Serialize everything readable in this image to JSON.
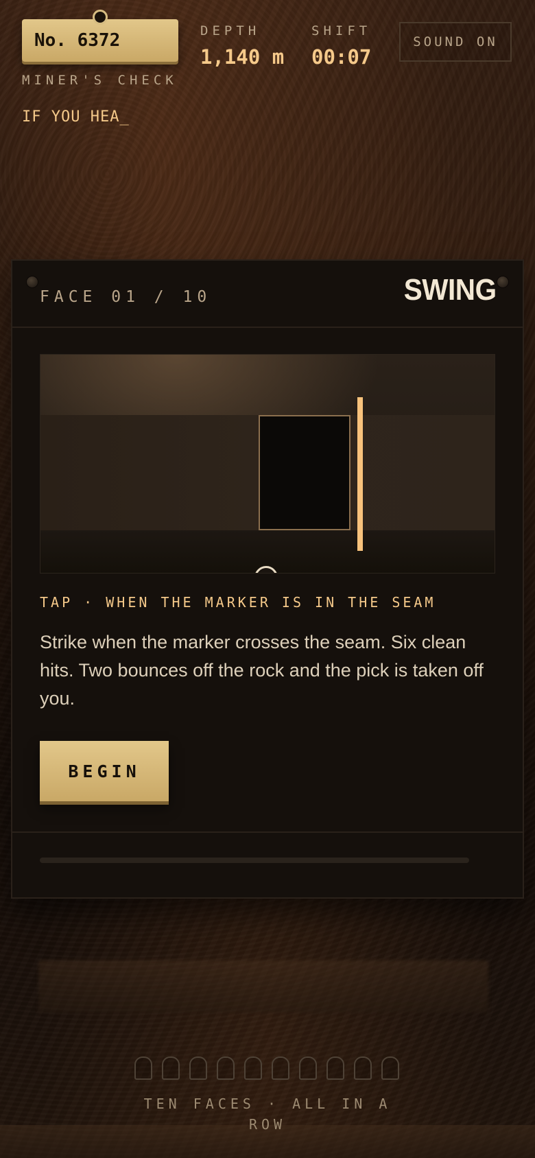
{
  "header": {
    "check_number": "No. 6372",
    "check_caption": "MINER'S CHECK",
    "depth": {
      "label": "DEPTH",
      "value": "1,140 m"
    },
    "shift": {
      "label": "SHIFT",
      "value": "00:07"
    },
    "sound_button": "SOUND ON",
    "ticker": "IF YOU HEA_"
  },
  "card": {
    "face_label": "FACE 01 / 10",
    "title": "SWING",
    "instruction_heading": "TAP · WHEN THE MARKER IS IN THE SEAM",
    "instruction_body": "Strike when the marker crosses the seam. Six clean hits. Two bounces off the rock and the pick is taken off you.",
    "begin_button": "BEGIN",
    "progress_fraction": 0
  },
  "footer": {
    "faces_total": 10,
    "faces_done": 0,
    "caption": "TEN FACES · ALL IN A ROW"
  },
  "colors": {
    "accent": "#f5c98a",
    "brass": "#c9a866",
    "marker": "#f8c27c",
    "card_bg": "#15100c"
  }
}
